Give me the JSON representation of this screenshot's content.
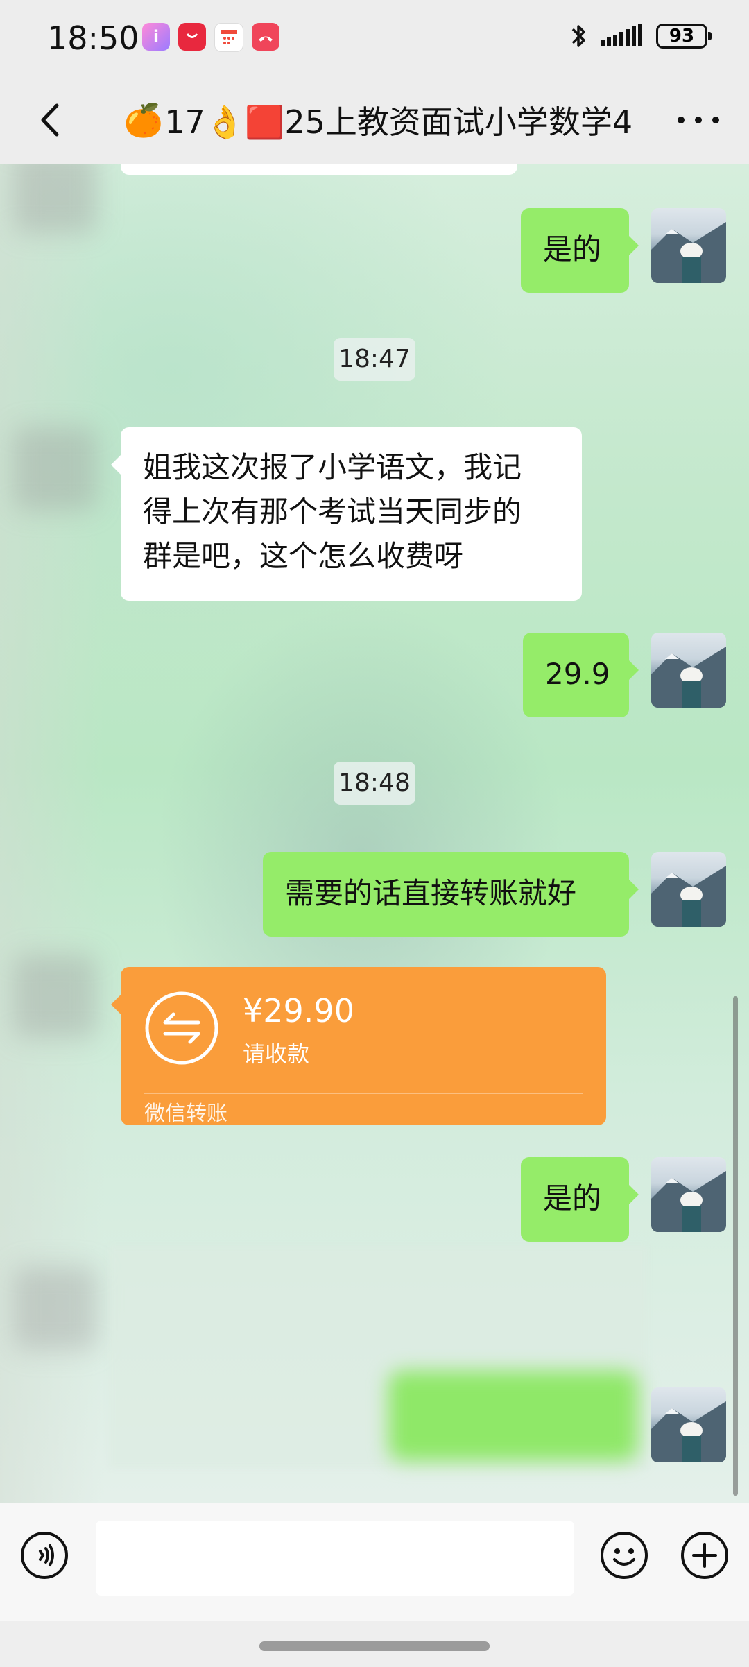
{
  "status_bar": {
    "time": "18:50",
    "battery": "93",
    "app_icons": [
      "i",
      "App Gallery",
      "calendar",
      "phone"
    ]
  },
  "nav": {
    "title": "17👌🟥25上教资面试小学数学4",
    "title_prefix_emoji": "🍊",
    "back_icon": "chevron-left-icon",
    "more_icon": "ellipsis-icon"
  },
  "messages": [
    {
      "type": "out",
      "text": "是的"
    },
    {
      "type": "time",
      "text": "18:47"
    },
    {
      "type": "in",
      "lines": [
        "姐我这次报了小学语文，我记",
        "得上次有那个考试当天同步的",
        "群是吧，这个怎么收费呀"
      ]
    },
    {
      "type": "out",
      "text": "29.9"
    },
    {
      "type": "time",
      "text": "18:48"
    },
    {
      "type": "out",
      "text": "需要的话直接转账就好"
    },
    {
      "type": "transfer",
      "amount": "¥29.90",
      "status": "请收款",
      "label": "微信转账"
    },
    {
      "type": "out",
      "text": "是的"
    }
  ],
  "input_bar": {
    "voice_icon": "voice-icon",
    "emoji_icon": "emoji-icon",
    "plus_icon": "plus-icon"
  },
  "colors": {
    "outgoing_bubble": "#95ec69",
    "incoming_bubble": "#ffffff",
    "transfer_card": "#fa9d3b"
  }
}
